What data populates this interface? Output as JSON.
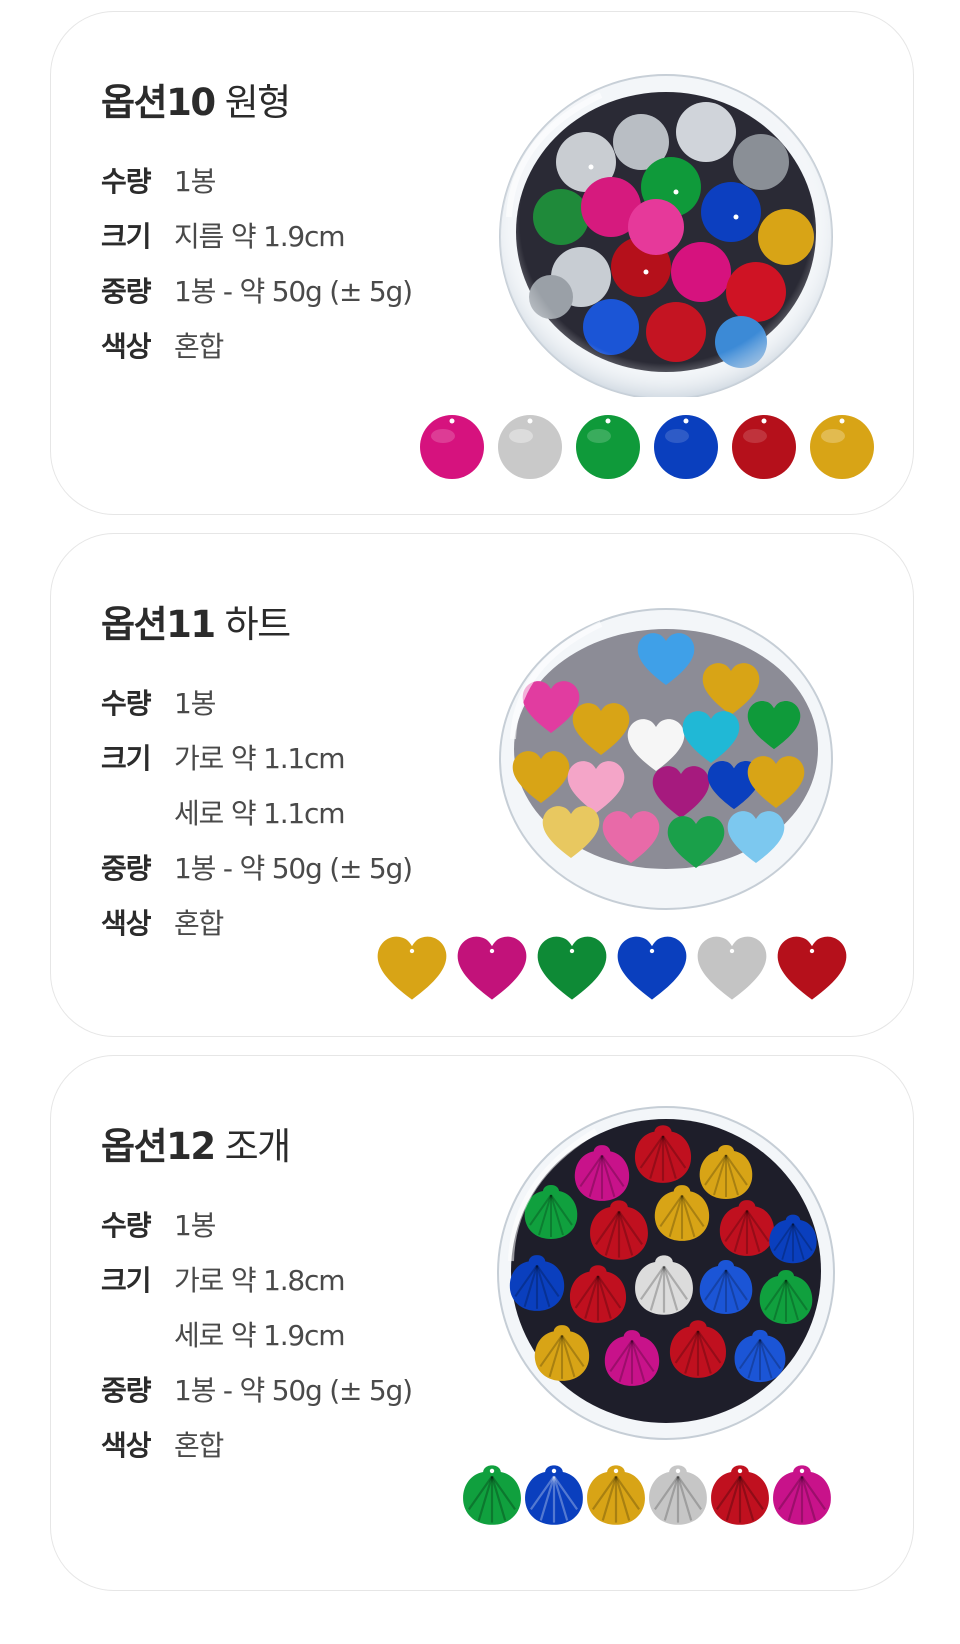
{
  "options": [
    {
      "number_label": "옵션10",
      "shape_label": "원형",
      "specs": [
        {
          "label": "수량",
          "value": "1봉"
        },
        {
          "label": "크기",
          "value": "지름 약 1.9cm"
        },
        {
          "label": "중량",
          "value": "1봉 - 약 50g (± 5g)"
        },
        {
          "label": "색상",
          "value": "혼합"
        }
      ],
      "swatch_shape": "circle-sequin",
      "swatch_colors": [
        "#d6127e",
        "#c9c9c9",
        "#0f9a3a",
        "#0a3fbe",
        "#b5101b",
        "#d8a416"
      ]
    },
    {
      "number_label": "옵션11",
      "shape_label": "하트",
      "specs": [
        {
          "label": "수량",
          "value": "1봉"
        },
        {
          "label": "크기",
          "value": "가로 약 1.1cm"
        },
        {
          "label": "",
          "value": "세로 약 1.1cm"
        },
        {
          "label": "중량",
          "value": "1봉 - 약 50g (± 5g)"
        },
        {
          "label": "색상",
          "value": "혼합"
        }
      ],
      "swatch_shape": "heart-sequin",
      "swatch_colors": [
        "#d8a416",
        "#c2127a",
        "#0e8a36",
        "#0a3fbe",
        "#c4c4c4",
        "#b5101b"
      ]
    },
    {
      "number_label": "옵션12",
      "shape_label": "조개",
      "specs": [
        {
          "label": "수량",
          "value": "1봉"
        },
        {
          "label": "크기",
          "value": "가로 약 1.8cm"
        },
        {
          "label": "",
          "value": "세로 약 1.9cm"
        },
        {
          "label": "중량",
          "value": "1봉 - 약 50g (± 5g)"
        },
        {
          "label": "색상",
          "value": "혼합"
        }
      ],
      "swatch_shape": "shell-sequin",
      "swatch_colors": [
        "#10a03e",
        "#0a3fbe",
        "#d8a416",
        "#c6c6c6",
        "#c0101f",
        "#c8128a"
      ]
    }
  ]
}
